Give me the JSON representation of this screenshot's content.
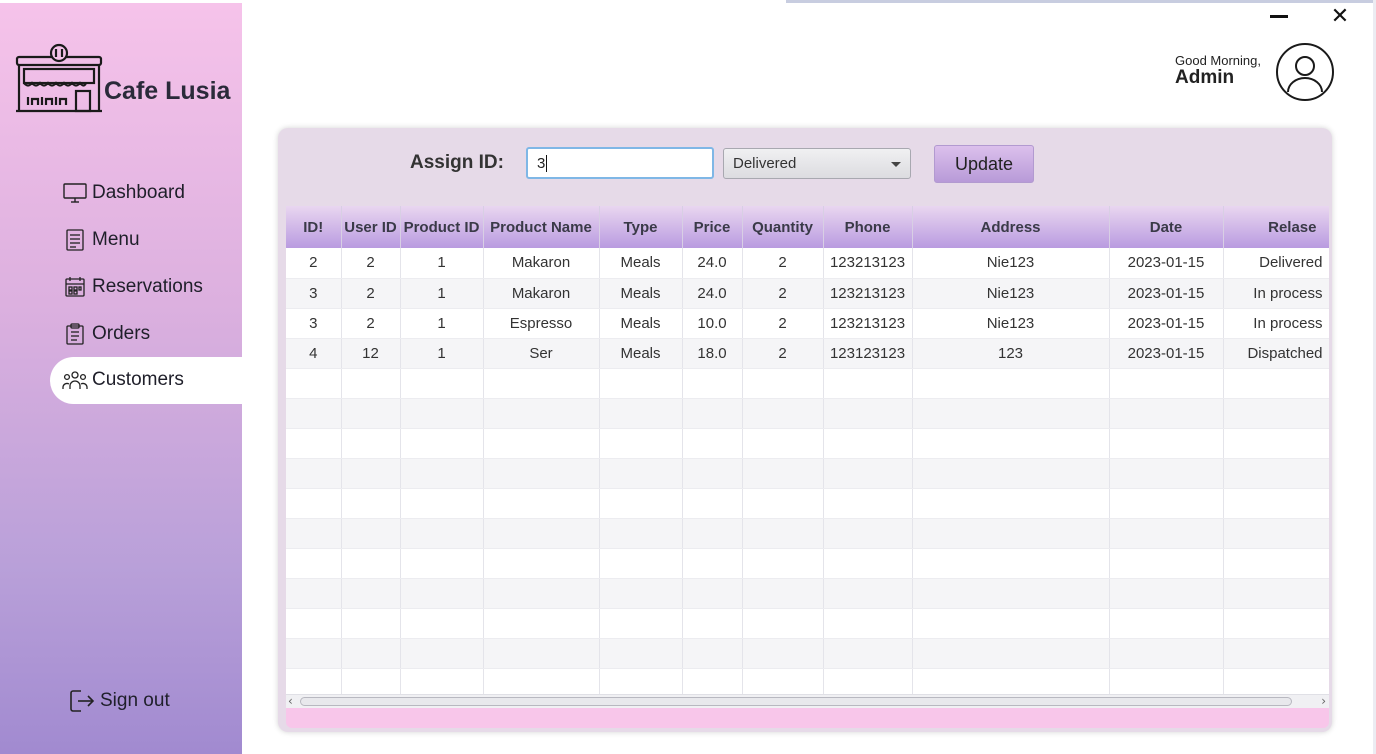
{
  "app": {
    "brand": "Cafe Lusia"
  },
  "sidebar": {
    "items": [
      {
        "label": "Dashboard",
        "icon": "monitor-icon"
      },
      {
        "label": "Menu",
        "icon": "menu-icon"
      },
      {
        "label": "Reservations",
        "icon": "calendar-icon"
      },
      {
        "label": "Orders",
        "icon": "clipboard-icon"
      },
      {
        "label": "Customers",
        "icon": "users-icon",
        "active": true
      }
    ],
    "signout_label": "Sign out"
  },
  "header": {
    "greeting": "Good Morning,",
    "username": "Admin"
  },
  "assign": {
    "label": "Assign ID:",
    "input_value": "3",
    "status_selected": "Delivered",
    "update_label": "Update"
  },
  "table": {
    "columns": [
      "ID!",
      "User ID",
      "Product ID",
      "Product Name",
      "Type",
      "Price",
      "Quantity",
      "Phone",
      "Address",
      "Date",
      "Relase"
    ],
    "rows": [
      [
        "2",
        "2",
        "1",
        "Makaron",
        "Meals",
        "24.0",
        "2",
        "123213123",
        "Nie123",
        "2023-01-15",
        "Delivered"
      ],
      [
        "3",
        "2",
        "1",
        "Makaron",
        "Meals",
        "24.0",
        "2",
        "123213123",
        "Nie123",
        "2023-01-15",
        "In process"
      ],
      [
        "3",
        "2",
        "1",
        "Espresso",
        "Meals",
        "10.0",
        "2",
        "123213123",
        "Nie123",
        "2023-01-15",
        "In process"
      ],
      [
        "4",
        "12",
        "1",
        "Ser",
        "Meals",
        "18.0",
        "2",
        "123123123",
        "123",
        "2023-01-15",
        "Dispatched"
      ]
    ],
    "empty_rows": 11
  },
  "colors": {
    "sidebar_top": "#f6c3ea",
    "sidebar_bottom": "#a18ad0",
    "header_gradient_top": "#e9d6f0",
    "header_gradient_bottom": "#b99be0",
    "panel_bg": "#e6dae8",
    "panel_footer": "#f8c6ea"
  }
}
